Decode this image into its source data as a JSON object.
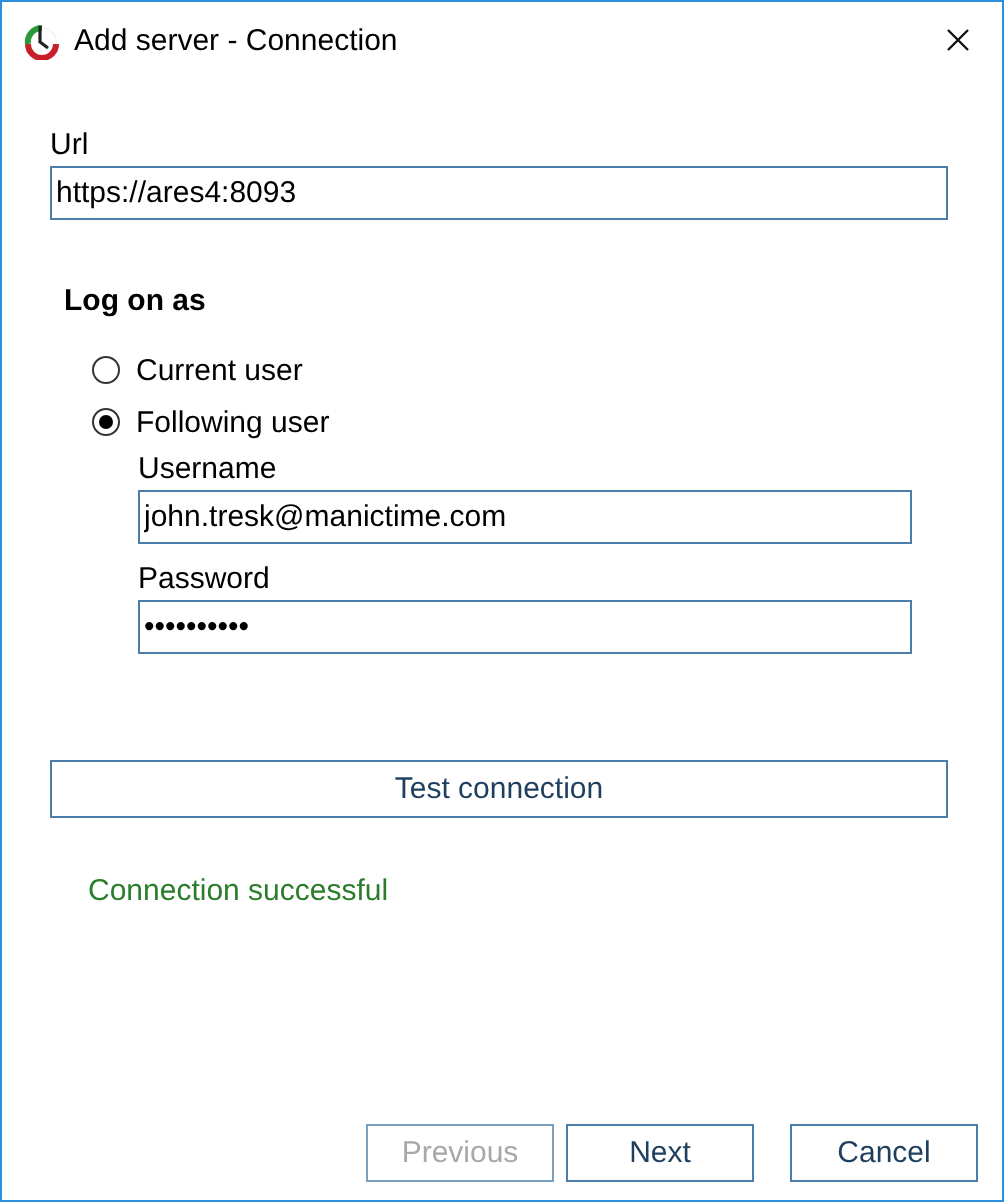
{
  "window": {
    "title": "Add server - Connection"
  },
  "url": {
    "label": "Url",
    "value": "https://ares4:8093"
  },
  "log_on_as": {
    "heading": "Log on as",
    "options": [
      {
        "label": "Current user",
        "selected": false
      },
      {
        "label": "Following user",
        "selected": true
      }
    ],
    "username": {
      "label": "Username",
      "value": "john.tresk@manictime.com"
    },
    "password": {
      "label": "Password",
      "value": "••••••••••"
    }
  },
  "test_button": {
    "label": "Test connection"
  },
  "status": {
    "text": "Connection successful",
    "kind": "success"
  },
  "buttons": [
    {
      "label": "Previous",
      "disabled": true
    },
    {
      "label": "Next",
      "disabled": false
    },
    {
      "label": "Cancel",
      "disabled": false
    }
  ]
}
